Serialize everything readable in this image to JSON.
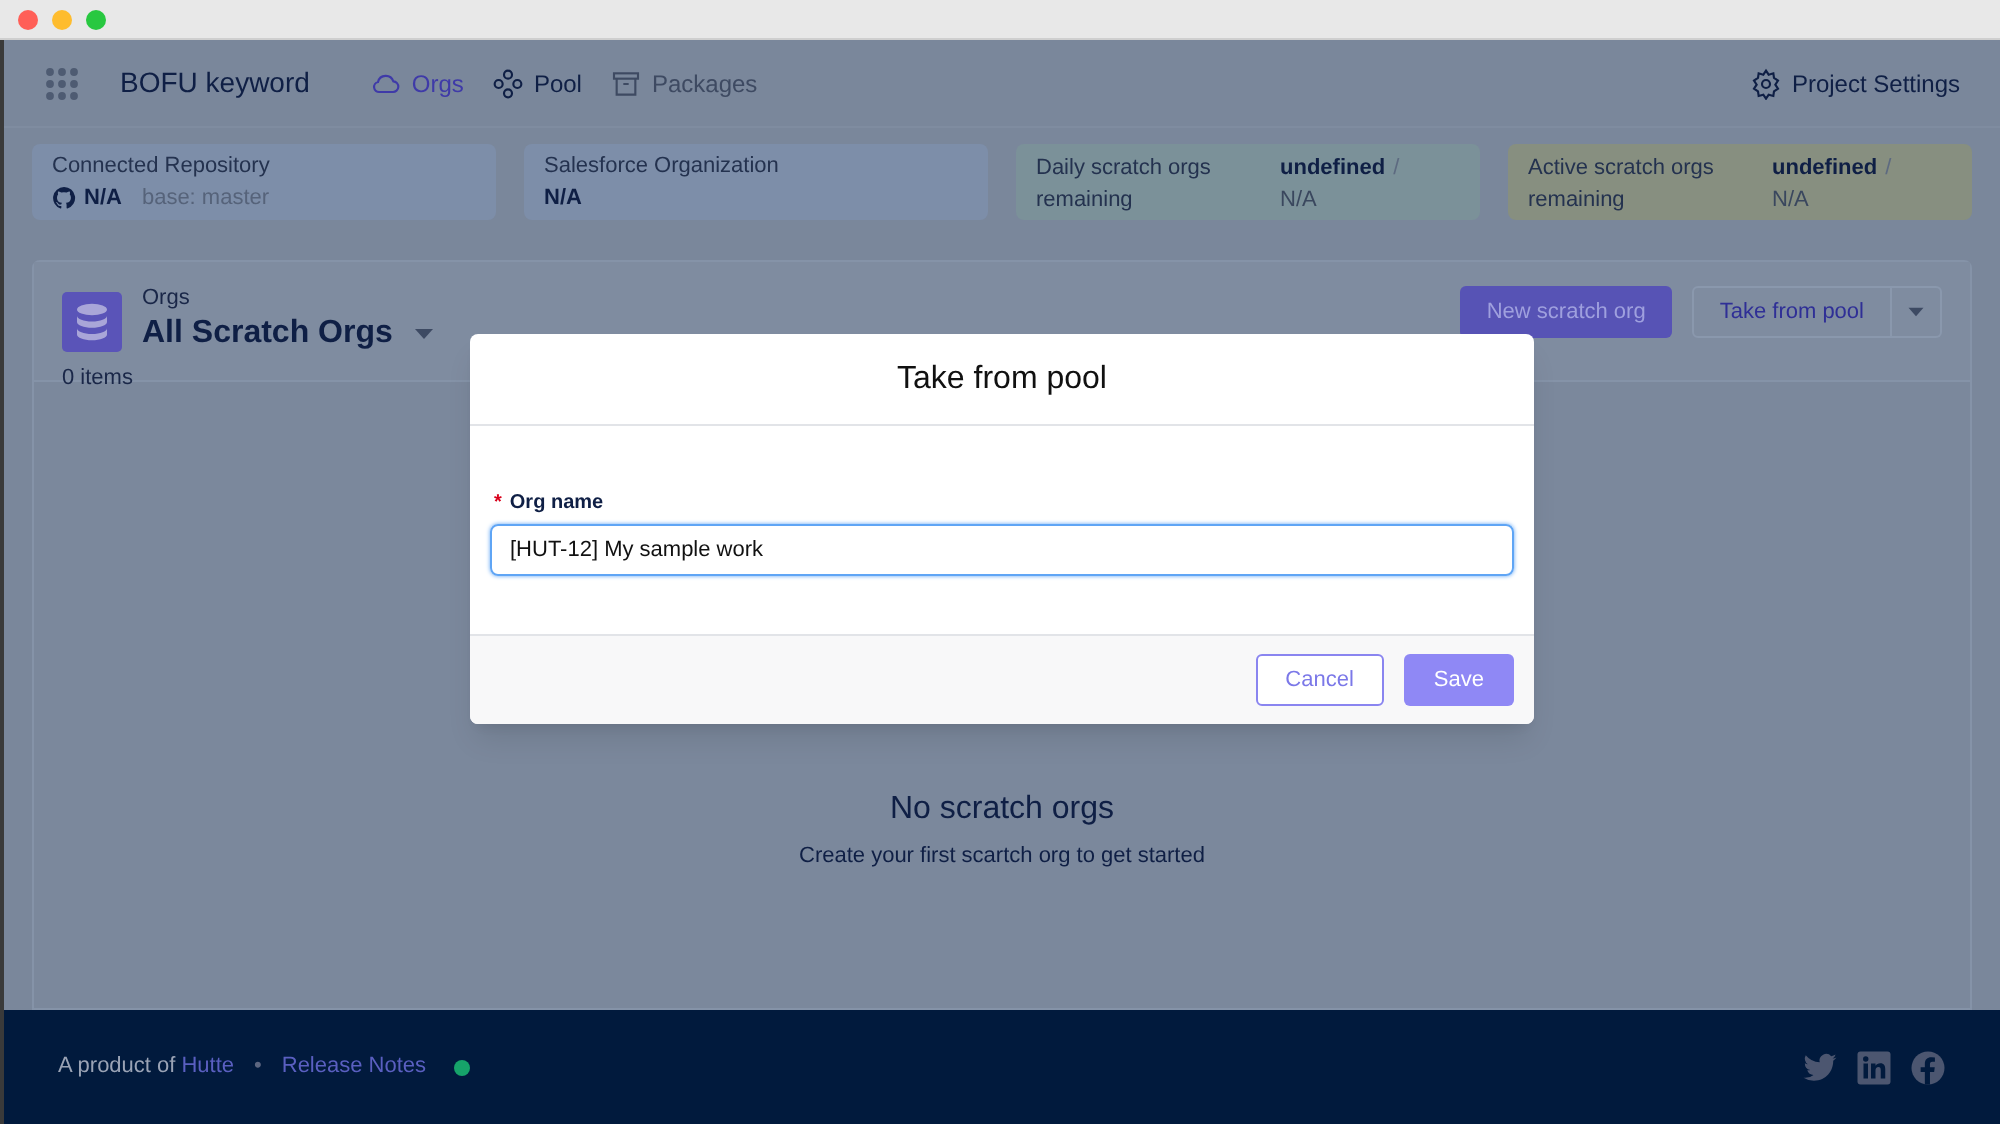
{
  "header": {
    "project": "BOFU keyword",
    "nav": [
      {
        "label": "Orgs",
        "selected": true,
        "disabled": false
      },
      {
        "label": "Pool",
        "selected": false,
        "disabled": false
      },
      {
        "label": "Packages",
        "selected": false,
        "disabled": true
      }
    ],
    "settings": "Project Settings"
  },
  "info_cards": [
    {
      "kind": "repo",
      "label": "Connected Repository",
      "value": "N/A",
      "detail": "base: master"
    },
    {
      "kind": "plain",
      "label": "Salesforce Organization",
      "value": "N/A"
    },
    {
      "kind": "quota",
      "label": "Daily scratch orgs remaining",
      "value": "undefined",
      "separator": "/",
      "limit": "N/A",
      "color": "#7b9199"
    },
    {
      "kind": "quota",
      "label": "Active scratch orgs remaining",
      "value": "undefined",
      "separator": "/",
      "limit": "N/A",
      "color": "#878f80"
    }
  ],
  "panel": {
    "caption": "Orgs",
    "title": "All Scratch Orgs",
    "count": "0 items",
    "primary_button": "New scratch org",
    "secondary_button": "Take from pool",
    "empty_title": "No scratch orgs",
    "empty_text": "Create your first scartch org to get started"
  },
  "dialog": {
    "title": "Take from pool",
    "field_label": "Org name",
    "required_mark": "*",
    "value": "[HUT-12] My sample work",
    "cancel": "Cancel",
    "save": "Save"
  },
  "footer": {
    "prefix": "A product of",
    "link": "Hutte",
    "separator": "•",
    "release_notes": "Release Notes",
    "online": true
  }
}
